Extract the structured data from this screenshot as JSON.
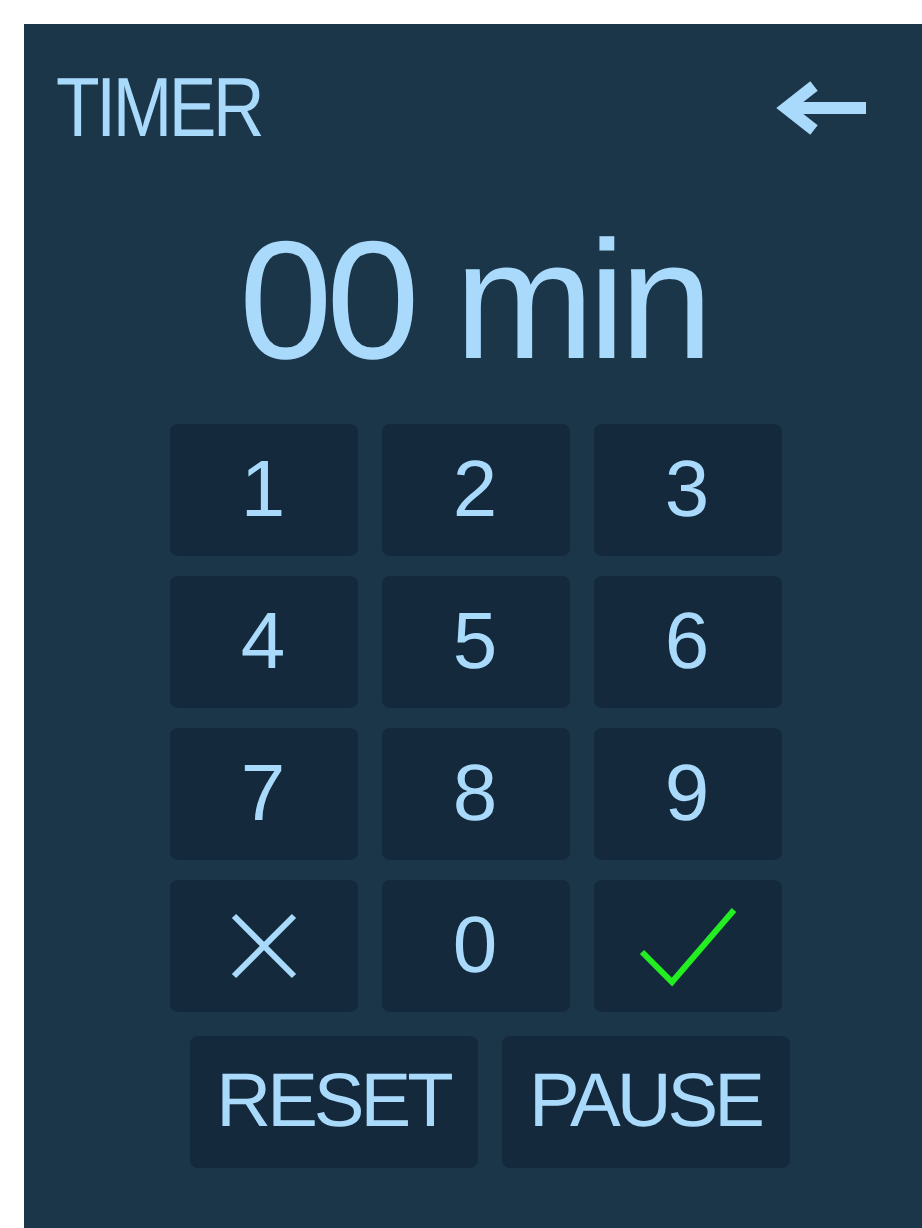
{
  "header": {
    "title": "TIMER"
  },
  "display": {
    "value": "00 min"
  },
  "keypad": [
    {
      "kind": "digit",
      "label": "1"
    },
    {
      "kind": "digit",
      "label": "2"
    },
    {
      "kind": "digit",
      "label": "3"
    },
    {
      "kind": "digit",
      "label": "4"
    },
    {
      "kind": "digit",
      "label": "5"
    },
    {
      "kind": "digit",
      "label": "6"
    },
    {
      "kind": "digit",
      "label": "7"
    },
    {
      "kind": "digit",
      "label": "8"
    },
    {
      "kind": "digit",
      "label": "9"
    },
    {
      "kind": "clear"
    },
    {
      "kind": "digit",
      "label": "0"
    },
    {
      "kind": "confirm"
    }
  ],
  "actions": [
    "RESET",
    "PAUSE"
  ]
}
